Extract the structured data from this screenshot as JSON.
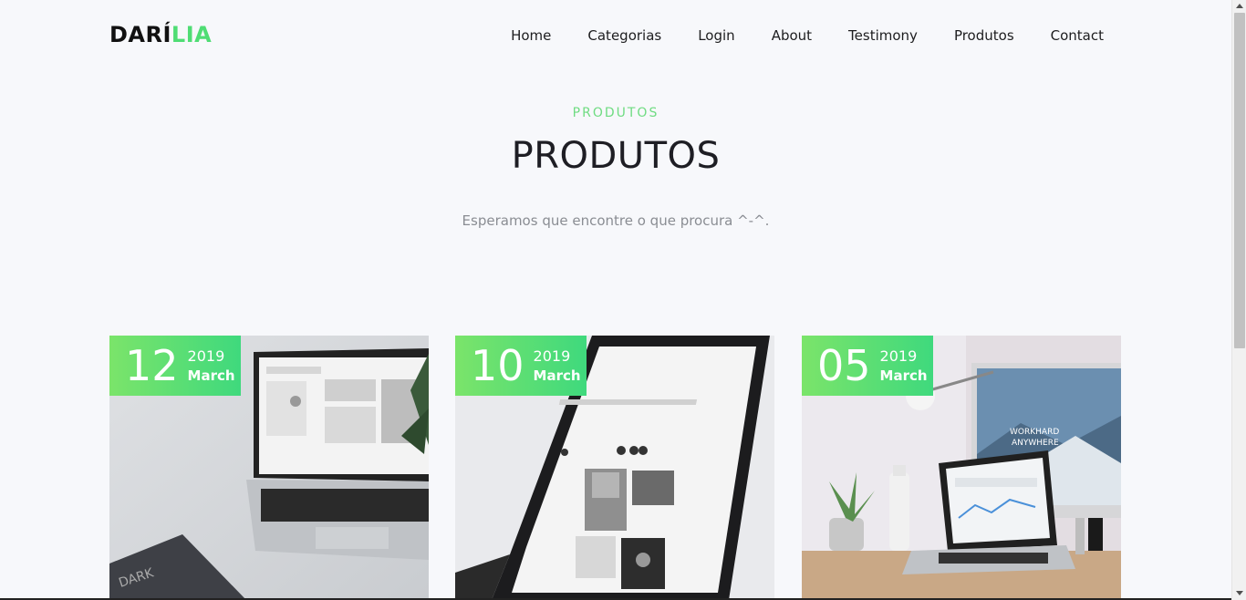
{
  "header": {
    "logo_part1": "DARÍ",
    "logo_part2": "LIA",
    "nav": [
      "Home",
      "Categorias",
      "Login",
      "About",
      "Testimony",
      "Produtos",
      "Contact"
    ]
  },
  "section": {
    "eyebrow": "PRODUTOS",
    "title": "PRODUTOS",
    "subtitle": "Esperamos que encontre o que procura ^-^."
  },
  "cards": [
    {
      "day": "12",
      "year": "2019",
      "month": "March"
    },
    {
      "day": "10",
      "year": "2019",
      "month": "March"
    },
    {
      "day": "05",
      "year": "2019",
      "month": "March"
    }
  ],
  "colors": {
    "accent": "#4fdd74",
    "badge_start": "#7be46a",
    "badge_end": "#3fd97d",
    "background": "#f7f8fb"
  }
}
